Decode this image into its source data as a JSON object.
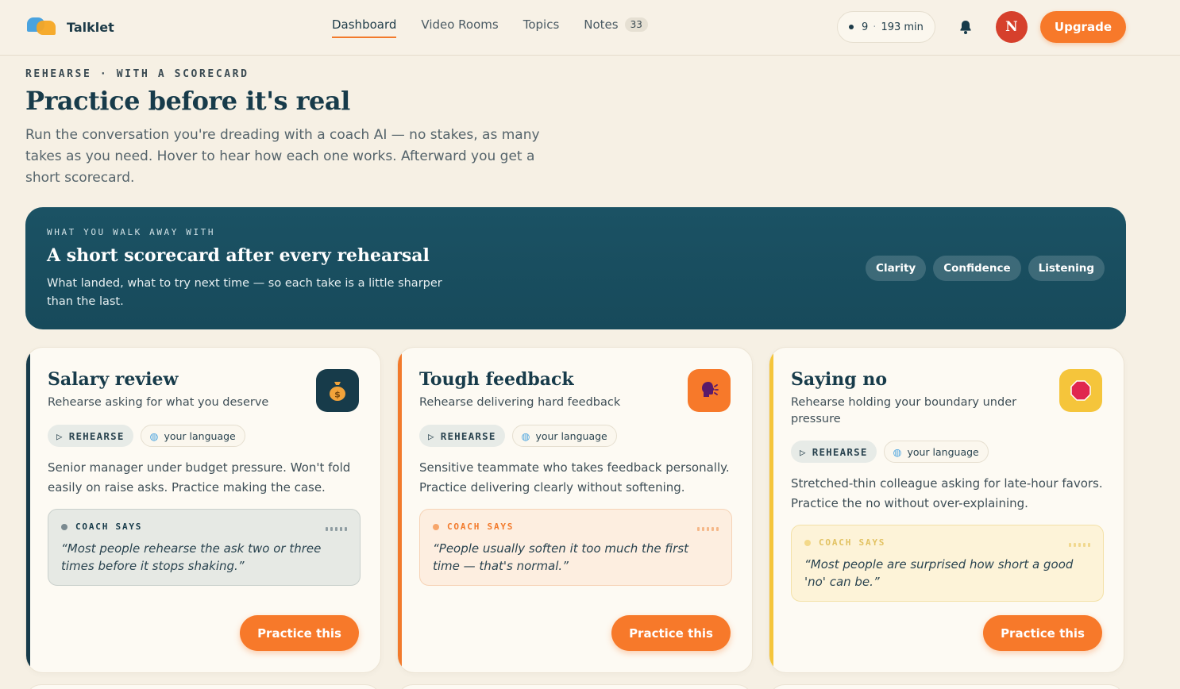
{
  "brand": {
    "name": "Talklet"
  },
  "nav": [
    {
      "label": "Dashboard",
      "active": true
    },
    {
      "label": "Video Rooms"
    },
    {
      "label": "Topics"
    },
    {
      "label": "Notes",
      "badge": "33"
    }
  ],
  "stats": {
    "streak": "9",
    "minutes": "193 min"
  },
  "user": {
    "initial": "N"
  },
  "upgrade_label": "Upgrade",
  "hero": {
    "eyebrow": "REHEARSE · WITH A SCORECARD",
    "title": "Practice before it's real",
    "subtitle": "Run the conversation you're dreading with a coach AI — no stakes, as many takes as you need. Hover to hear how each one works. Afterward you get a short scorecard."
  },
  "banner": {
    "eyebrow": "WHAT YOU WALK AWAY WITH",
    "title": "A short scorecard after every rehearsal",
    "subtitle": "What landed, what to try next time — so each take is a little sharper than the last.",
    "chips": [
      "Clarity",
      "Confidence",
      "Listening"
    ]
  },
  "cards": [
    {
      "title": "Salary review",
      "subtitle": "Rehearse asking for what you deserve",
      "tag_mode": "REHEARSE",
      "tag_lang": "your language",
      "description": "Senior manager under budget pressure. Won't fold easily on raise asks. Practice making the case.",
      "coach_label": "COACH SAYS",
      "coach_quote": "“Most people rehearse the ask two or three times before it stops shaking.”",
      "cta": "Practice this",
      "icon": "money-bag-icon",
      "accent": "#173b4a"
    },
    {
      "title": "Tough feedback",
      "subtitle": "Rehearse delivering hard feedback",
      "tag_mode": "REHEARSE",
      "tag_lang": "your language",
      "description": "Sensitive teammate who takes feedback personally. Practice delivering clearly without softening.",
      "coach_label": "COACH SAYS",
      "coach_quote": "“People usually soften it too much the first time — that's normal.”",
      "cta": "Practice this",
      "icon": "speaking-head-icon",
      "accent": "#f27a2c"
    },
    {
      "title": "Saying no",
      "subtitle": "Rehearse holding your boundary under pressure",
      "tag_mode": "REHEARSE",
      "tag_lang": "your language",
      "description": "Stretched-thin colleague asking for late-hour favors. Practice the no without over-explaining.",
      "coach_label": "COACH SAYS",
      "coach_quote": "“Most people are surprised how short a good 'no' can be.”",
      "cta": "Practice this",
      "icon": "stop-sign-icon",
      "accent": "#f5c53b"
    }
  ]
}
